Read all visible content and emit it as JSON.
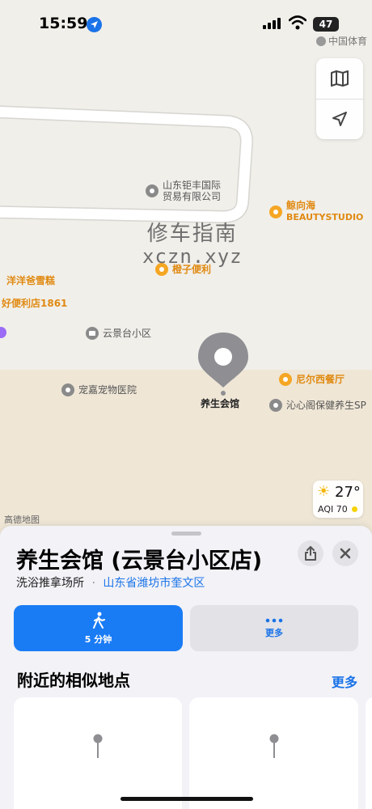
{
  "status_bar": {
    "time": "15:59",
    "battery": "47"
  },
  "map": {
    "top_right_poi": "中国体育",
    "pois": {
      "trade_company_line1": "山东钜丰国际",
      "trade_company_line2": "贸易有限公司",
      "jingxianghai_line1": "鲸向海",
      "jingxianghai_line2": "BEAUTYSTUDIO",
      "yangyang_cake": "洋洋爸雪糕",
      "chengzi_store": "橙子便利",
      "haobianli": "好便利店1861",
      "yunjingtai": "云景台小区",
      "pet_hospital": "宠嘉宠物医院",
      "selected_place": "养生会馆",
      "nier_restaurant": "尼尔西餐厅",
      "qinxinge": "沁心阁保健养生SP"
    },
    "watermark_line1": "修车指南",
    "watermark_line2": "xczn.xyz",
    "weather": {
      "temp": "27°",
      "aqi": "AQI 70"
    },
    "attribution": "高德地图"
  },
  "sheet": {
    "title": "养生会馆 (云景台小区店)",
    "category": "洗浴推拿场所",
    "separator": "·",
    "location": "山东省潍坊市奎文区",
    "actions": {
      "walk_label": "5 分钟",
      "more_label": "更多"
    },
    "nearby_title": "附近的相似地点",
    "nearby_more": "更多"
  },
  "colors": {
    "accent": "#1a7cf5",
    "poi_orange": "#f5a623",
    "map_bg": "#f1efea"
  }
}
